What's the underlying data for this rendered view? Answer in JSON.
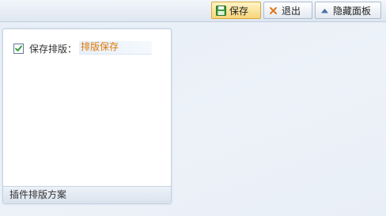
{
  "toolbar": {
    "save_label": "保存",
    "save_icon": "floppy-disk-icon",
    "exit_label": "退出",
    "exit_icon": "close-x-icon",
    "hide_label": "隐藏面板",
    "hide_icon": "triangle-up-icon"
  },
  "panel": {
    "option_label": "保存排版：",
    "option_checked": true,
    "option_value": "排版保存",
    "footer_title": "插件排版方案"
  },
  "colors": {
    "save_button_bg": "#f7d57a",
    "option_value_text": "#e07a0c",
    "close_icon": "#e0781a",
    "checkmark": "#2e9a2e"
  }
}
